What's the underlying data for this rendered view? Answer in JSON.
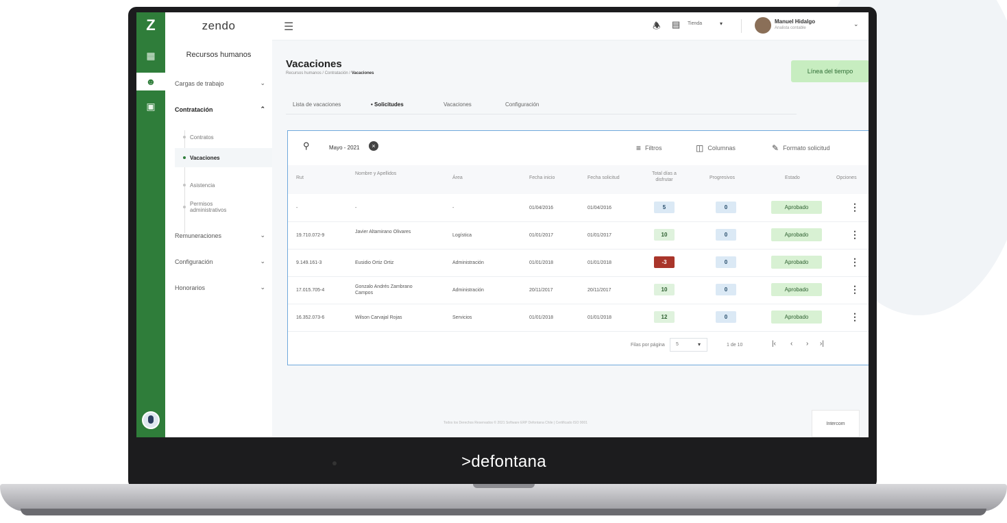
{
  "brand": ">defontana",
  "rail": {
    "logo": "Z",
    "icons": [
      "dashboard-icon",
      "users-icon",
      "briefcase-icon"
    ]
  },
  "sidebar": {
    "logo": "zendo",
    "title": "Recursos humanos",
    "items": [
      {
        "label": "Cargas de trabajo"
      },
      {
        "label": "Contratación"
      },
      {
        "label": "Remuneraciones"
      },
      {
        "label": "Configuración"
      },
      {
        "label": "Honorarios"
      }
    ],
    "sub_items": [
      {
        "label": "Contratos"
      },
      {
        "label": "Vacaciones"
      },
      {
        "label": "Asistencia"
      },
      {
        "label": "Permisos administrativos"
      }
    ]
  },
  "topbar": {
    "store_label": "Tienda",
    "user_name": "Manuel Hidalgo",
    "user_role": "Analista contable"
  },
  "page": {
    "title": "Vacaciones",
    "breadcrumb": [
      "Recursos humanos",
      "Contratación",
      "Vacaciones"
    ],
    "timeline_button": "Línea del tiempo"
  },
  "tabs": [
    {
      "label": "Lista de vacaciones"
    },
    {
      "label": "• Solicitudes"
    },
    {
      "label": "Vacaciones"
    },
    {
      "label": "Configuración"
    }
  ],
  "filter": {
    "chip": "Mayo - 2021",
    "filters_label": "Filtros",
    "columns_label": "Columnas",
    "format_label": "Formato solicitud"
  },
  "table": {
    "headers": [
      "Rut",
      "Nombre y Apellidos",
      "Área",
      "Fecha inicio",
      "Fecha solicitud",
      "Total días a disfrutar",
      "Progresivos",
      "Estado",
      "Opciones"
    ],
    "rows": [
      {
        "rut": "-",
        "nombre": "-",
        "area": "-",
        "inicio": "01/04/2016",
        "solicitud": "01/04/2016",
        "total": "5",
        "total_color": "blue",
        "progresivos": "0",
        "estado": "Aprobado"
      },
      {
        "rut": "19.710.072-9",
        "nombre": "Javier Altamirano Olivares",
        "area": "Logística",
        "inicio": "01/01/2017",
        "solicitud": "01/01/2017",
        "total": "10",
        "total_color": "green",
        "progresivos": "0",
        "estado": "Aprobado"
      },
      {
        "rut": "9.149.161-3",
        "nombre": "Eusidio Ortiz Ortiz",
        "area": "Administración",
        "inicio": "01/01/2018",
        "solicitud": "01/01/2018",
        "total": "-3",
        "total_color": "red",
        "progresivos": "0",
        "estado": "Aprobado"
      },
      {
        "rut": "17.015.705-4",
        "nombre": "Gonzalo Andrés Zambrano Campos",
        "area": "Administración",
        "inicio": "20/11/2017",
        "solicitud": "20/11/2017",
        "total": "10",
        "total_color": "green",
        "progresivos": "0",
        "estado": "Aprobado"
      },
      {
        "rut": "16.352.073-6",
        "nombre": "Wilson Carvajal Rojas",
        "area": "Servicios",
        "inicio": "01/01/2018",
        "solicitud": "01/01/2018",
        "total": "12",
        "total_color": "green",
        "progresivos": "0",
        "estado": "Aprobado"
      }
    ]
  },
  "pagination": {
    "rows_label": "Filas por página",
    "rows_value": "5",
    "range": "1 de 10"
  },
  "footer": {
    "text": "Todos los Derechos Reservados © 2021 Software ERP Defontana Chile | Certificado ISO 9001",
    "interpom_button": "Intercom"
  }
}
